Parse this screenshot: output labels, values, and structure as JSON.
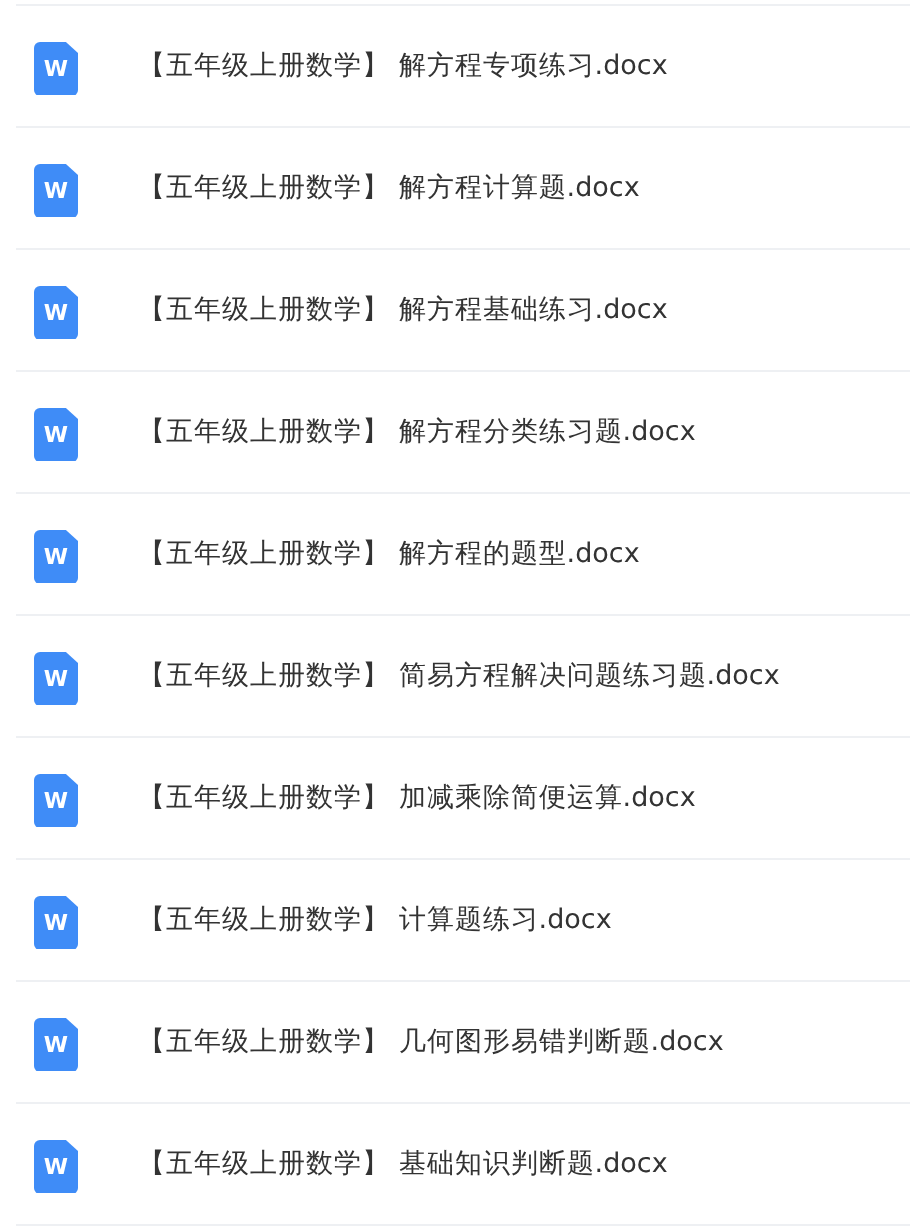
{
  "files": [
    {
      "icon_text": "W",
      "name": "【五年级上册数学】 解方程专项练习.docx"
    },
    {
      "icon_text": "W",
      "name": "【五年级上册数学】 解方程计算题.docx"
    },
    {
      "icon_text": "W",
      "name": "【五年级上册数学】 解方程基础练习.docx"
    },
    {
      "icon_text": "W",
      "name": "【五年级上册数学】 解方程分类练习题.docx"
    },
    {
      "icon_text": "W",
      "name": "【五年级上册数学】 解方程的题型.docx"
    },
    {
      "icon_text": "W",
      "name": "【五年级上册数学】 简易方程解决问题练习题.docx"
    },
    {
      "icon_text": "W",
      "name": "【五年级上册数学】 加减乘除简便运算.docx"
    },
    {
      "icon_text": "W",
      "name": "【五年级上册数学】 计算题练习.docx"
    },
    {
      "icon_text": "W",
      "name": "【五年级上册数学】 几何图形易错判断题.docx"
    },
    {
      "icon_text": "W",
      "name": "【五年级上册数学】 基础知识判断题.docx"
    }
  ]
}
